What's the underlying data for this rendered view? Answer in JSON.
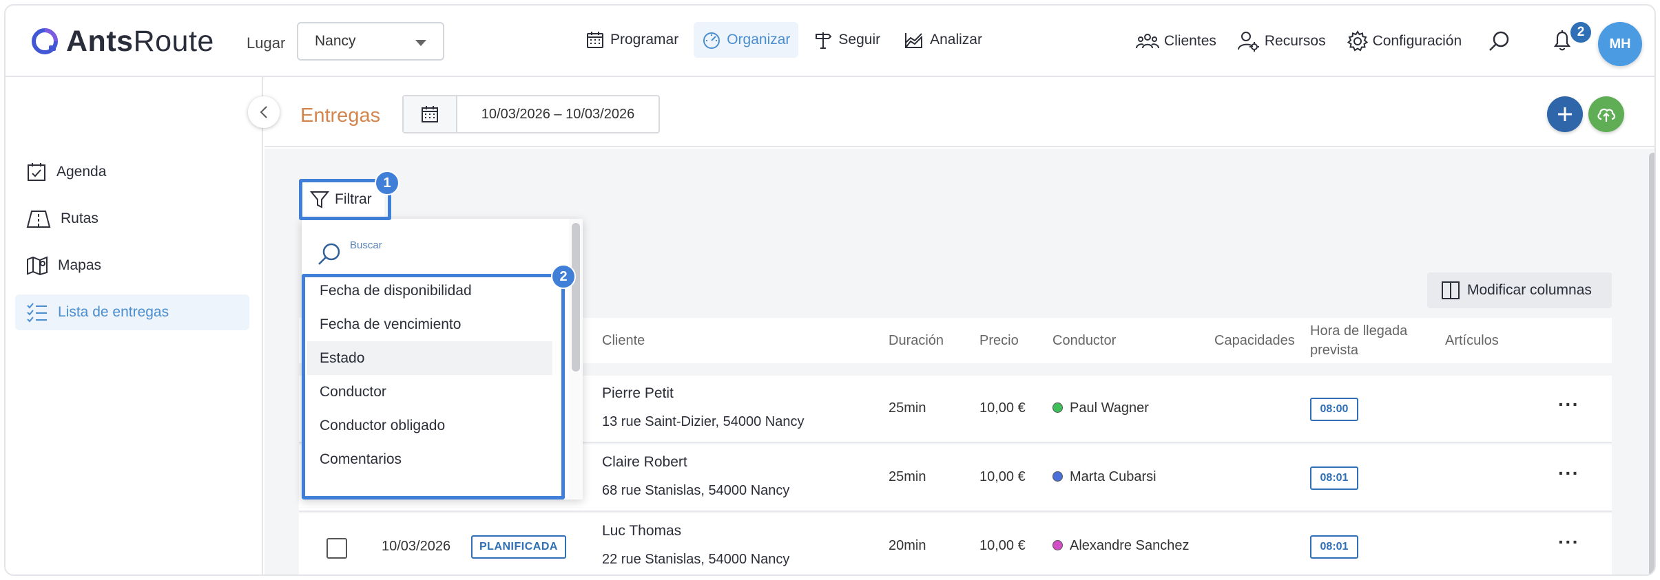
{
  "app": {
    "logo_text_bold": "Ants",
    "logo_text_light": "Route",
    "place_label": "Lugar",
    "place_value": "Nancy"
  },
  "main_nav": [
    {
      "label": "Programar",
      "icon": "calendar-icon",
      "active": false
    },
    {
      "label": "Organizar",
      "icon": "gauge-icon",
      "active": true
    },
    {
      "label": "Seguir",
      "icon": "signpost-icon",
      "active": false
    },
    {
      "label": "Analizar",
      "icon": "chart-icon",
      "active": false
    }
  ],
  "right_nav": [
    {
      "label": "Clientes",
      "icon": "clients-icon"
    },
    {
      "label": "Recursos",
      "icon": "resources-icon"
    },
    {
      "label": "Configuración",
      "icon": "gear-icon"
    }
  ],
  "notifications": {
    "count": "2"
  },
  "user": {
    "initials": "MH"
  },
  "sidebar": {
    "items": [
      {
        "label": "Agenda",
        "icon": "agenda-icon",
        "active": false
      },
      {
        "label": "Rutas",
        "icon": "routes-icon",
        "active": false
      },
      {
        "label": "Mapas",
        "icon": "map-icon",
        "active": false
      },
      {
        "label": "Lista de entregas",
        "icon": "list-icon",
        "active": true
      }
    ]
  },
  "page": {
    "title": "Entregas",
    "date_range": "10/03/2026 – 10/03/2026"
  },
  "filter": {
    "label": "Filtrar",
    "search_placeholder": "Buscar",
    "options": [
      "Fecha de disponibilidad",
      "Fecha de vencimiento",
      "Estado",
      "Conductor",
      "Conductor obligado",
      "Comentarios"
    ],
    "hovered_index": 2
  },
  "annotations": {
    "filter_marker": "1",
    "options_marker": "2"
  },
  "table": {
    "modify_columns_label": "Modificar columnas",
    "headers": {
      "cliente": "Cliente",
      "duracion": "Duración",
      "precio": "Precio",
      "conductor": "Conductor",
      "capacidades": "Capacidades",
      "hora_line1": "Hora de llegada",
      "hora_line2": "prevista",
      "articulos": "Artículos"
    },
    "rows": [
      {
        "date": "",
        "status": "",
        "client_name": "Pierre Petit",
        "client_address": "13 rue Saint-Dizier, 54000 Nancy",
        "duration": "25min",
        "price": "10,00 €",
        "driver": "Paul Wagner",
        "driver_color": "#3fbf5a",
        "eta": "08:00"
      },
      {
        "date": "",
        "status": "",
        "client_name": "Claire Robert",
        "client_address": "68 rue Stanislas, 54000 Nancy",
        "duration": "25min",
        "price": "10,00 €",
        "driver": "Marta Cubarsi",
        "driver_color": "#4a6fd8",
        "eta": "08:01"
      },
      {
        "date": "10/03/2026",
        "status": "PLANIFICADA",
        "client_name": "Luc Thomas",
        "client_address": "22 rue Stanislas, 54000 Nancy",
        "duration": "20min",
        "price": "10,00 €",
        "driver": "Alexandre Sanchez",
        "driver_color": "#d24fc6",
        "eta": "08:01"
      }
    ]
  },
  "colors": {
    "accent": "#4a8ed0",
    "title_orange": "#d4854d",
    "annotation_blue": "#3f7fd7",
    "fab_add": "#2f66a9",
    "fab_cloud": "#5fae55"
  }
}
